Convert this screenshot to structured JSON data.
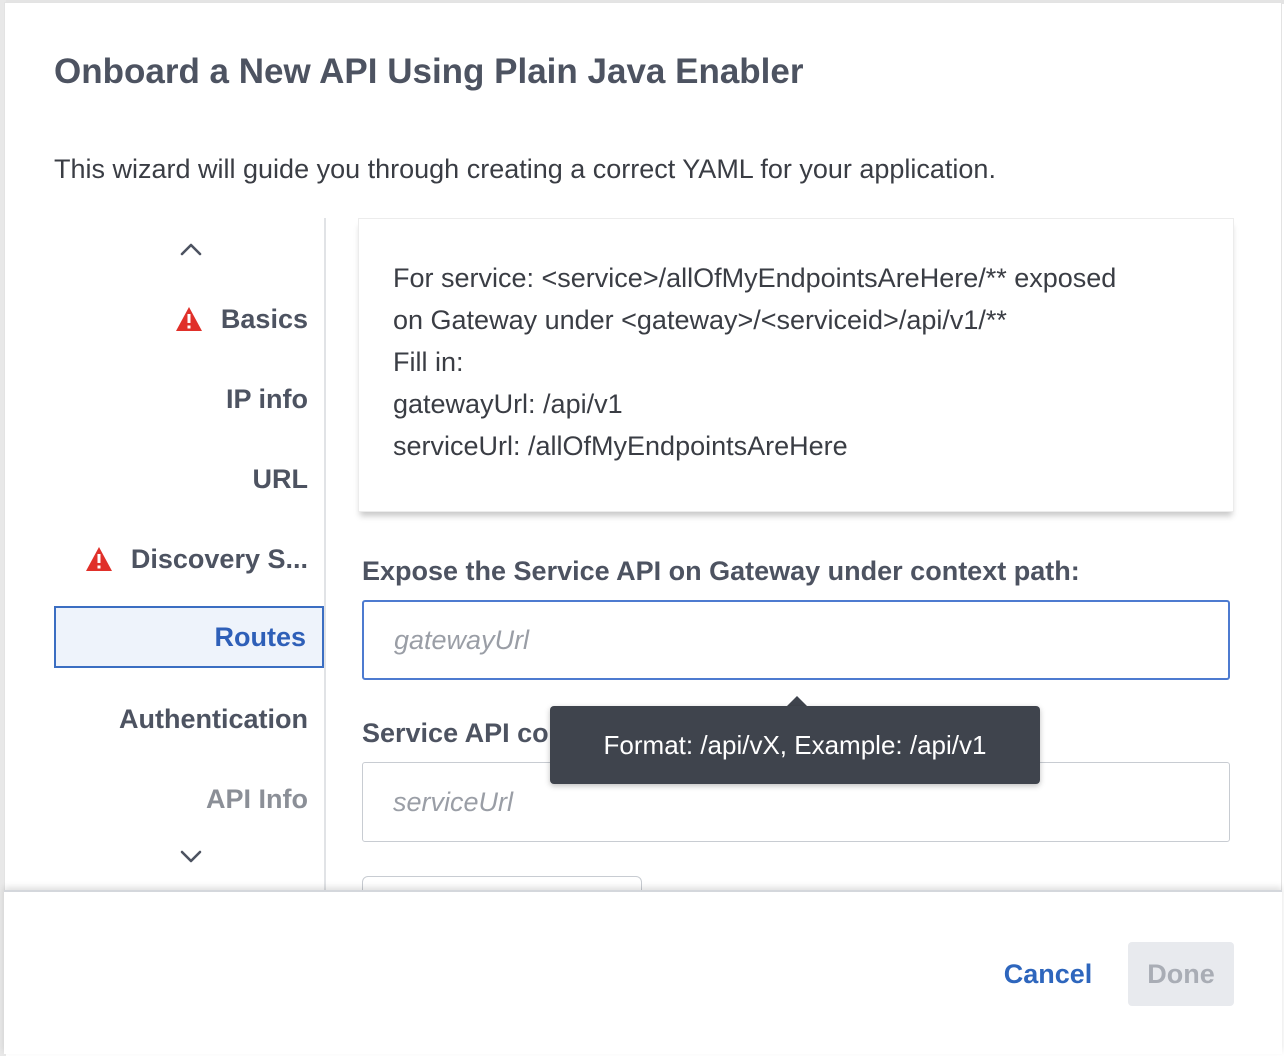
{
  "dialog": {
    "title": "Onboard a New API Using Plain Java Enabler",
    "subtitle": "This wizard will guide you through creating a correct YAML for your application."
  },
  "nav": {
    "items": [
      {
        "label": "Basics",
        "warning": true,
        "state": "normal"
      },
      {
        "label": "IP info",
        "warning": false,
        "state": "normal"
      },
      {
        "label": "URL",
        "warning": false,
        "state": "normal"
      },
      {
        "label": "Discovery S...",
        "warning": true,
        "state": "normal"
      },
      {
        "label": "Routes",
        "warning": false,
        "state": "active"
      },
      {
        "label": "Authentication",
        "warning": false,
        "state": "normal"
      },
      {
        "label": "API Info",
        "warning": false,
        "state": "dim"
      }
    ],
    "scroll_up_icon": "chevron-up-icon",
    "scroll_down_icon": "chevron-down-icon",
    "warning_icon": "warning-triangle-icon",
    "warning_color": "#e0302a",
    "active_color": "#2e5fb8"
  },
  "info_card": {
    "lines": [
      "For service: <service>/allOfMyEndpointsAreHere/** exposed",
      "on Gateway under <gateway>/<serviceid>/api/v1/**",
      "Fill in:",
      "gatewayUrl: /api/v1",
      "serviceUrl: /allOfMyEndpointsAreHere"
    ]
  },
  "form": {
    "gateway_label": "Expose the Service API on Gateway under context path:",
    "gateway_placeholder": "gatewayUrl",
    "gateway_value": "",
    "service_label": "Service API co",
    "service_placeholder": "serviceUrl",
    "service_value": ""
  },
  "tooltip": {
    "text": "Format: /api/vX, Example: /api/v1"
  },
  "footer": {
    "cancel_label": "Cancel",
    "done_label": "Done",
    "done_disabled": true
  }
}
